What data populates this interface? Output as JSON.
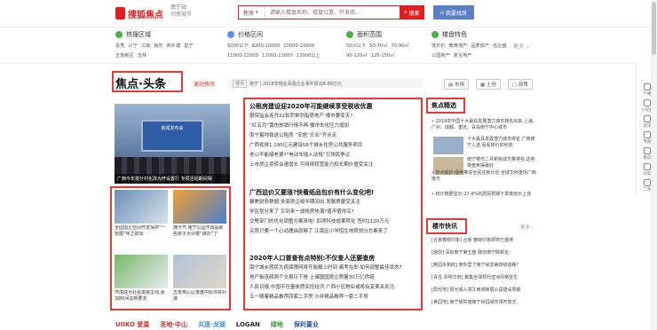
{
  "header": {
    "logo_text": "搜狐焦点",
    "city": "南宁站",
    "city_switch": "切换城市",
    "search_category": "新房",
    "search_placeholder": "请输入楼盘名称、楼盘位置、开发商...",
    "search_button": "搜索",
    "publish_button": "我要找房"
  },
  "categories": [
    {
      "title": "热搜区域",
      "icon_color": "#4caf50",
      "rows": [
        [
          "青秀",
          "兴宁",
          "江南",
          "良庆",
          "西乡塘",
          "邕宁"
        ],
        [
          "五象新区",
          "玉林"
        ]
      ]
    },
    {
      "title": "价格区间",
      "icon_color": "#5b8def",
      "rows": [
        [
          "6000以下",
          "8200-10000",
          "10000-11000"
        ],
        [
          "11000-12000",
          "12000-13000",
          "13000以上"
        ]
      ]
    },
    {
      "title": "面积范围",
      "icon_color": "#4caf50",
      "rows": [
        [
          "50㎡以下",
          "50-70㎡",
          "70-90㎡"
        ],
        [
          "90-120㎡",
          "120-150㎡"
        ]
      ]
    },
    {
      "title": "楼盘特色",
      "icon_color": "#4caf50",
      "rows": [
        [
          "低价价",
          "教育地产",
          "品质房产",
          "名企盘"
        ],
        [
          "公园地产",
          "复合地产"
        ]
      ]
    }
  ],
  "more_label": "更多",
  "focus": {
    "title": "焦点·头条",
    "scroll_tag": "滚动快讯",
    "ticker_tag": "楼市",
    "ticker_text": "南宁 | 2018年物业百强企业事件报出8.66亿元",
    "buttons": [
      "市场",
      "土地",
      "政策"
    ]
  },
  "hero": {
    "stage_text": "新闻发布会",
    "caption": "广西今年将分村化改为开设置行 专项活动期间相"
  },
  "thumbs": [
    {
      "caption": "全国国土空间开发保护“一张图”呼之欲出",
      "color_a": "#6a8fb8",
      "color_b": "#d8e2ea"
    },
    {
      "caption": "拥卡节 南宁公园不再是那些房子大伙楼“谁办”了",
      "color_a": "#f0a030",
      "color_b": "#4a7fd0"
    },
    {
      "caption": "环境成为社会发展主线,更加80间总新要求",
      "color_a": "#78b86a",
      "color_b": "#e8ecef"
    },
    {
      "caption": "五象核心区楼盘中原项目对接",
      "color_a": "#b0c4d8",
      "color_b": "#e0d6c8"
    }
  ],
  "news_blocks": [
    {
      "headline": "公租房建设迎2020年可能继续享受税收优惠",
      "lines": [
        "银保监会连开32张罚单剑指房地产 楼市要变天?",
        "“红五月”黄伤热销行情不再 楼市去化压力增加",
        "南宁着地铁送公租房 “安居”乐业“齐步走",
        "广西省排1.195亿元建设58个城乡住房公共服务项目",
        "老公不能接老婆?“电动车插入法规”引领民争议",
        "上市房企资转业速增长 可持续转营能力和长期价值受关注"
      ]
    },
    {
      "headline": "广西迫价又要涨?快看纸品包价有什么变化吧!",
      "lines": [
        "聚焦财务数据:多家房企收年期间出 发展质量受关注",
        "学区划分来了 又到来一波抢房热潮?值不值得买?",
        "交警部门的优化调整方案来啦!   四项科技成果转化 签约1120万元",
        "买房只要一个心动理由就够了   江南区小学招生地段划分方案来了"
      ]
    },
    {
      "headline": "2020年人口普查有点特别:不仅查人还要查房",
      "lines": [
        "南宁城乡居民大病保障网将开始报上时间   离考在即 如何调整最佳状态?",
        "地产板连续两个交易日下挫   土储国国房企质量30万亿供链",
        "人民日报:中国平仓量体质实控经济   广西小区物业或将有变革关到马",
        "五一随着精品推荐四套二手房   沙井精品推荐一套二手房"
      ]
    }
  ],
  "focus_pick": {
    "title": "焦点精选",
    "lead": "2019年中国十大最具发展潜力城市排名出来,上海、广州、成都、重庆、青岛南宁中心城市",
    "items": [
      {
        "text": "十大最具发展潜力城市排名 广西南宁入选,看看房价如何走",
        "color": "#9ab0c8"
      },
      {
        "text": "南宁楼市二月新房成交量排名,这些楼盘卖得最好",
        "color": "#c8b89a"
      }
    ],
    "points": [
      "热点解析:继续推进全民住房计划 全球华侨重现广西楼市",
      "统计数据显示:27.4%的居民预期下季度房价上涨"
    ]
  },
  "city_news": {
    "title": "楼市快讯",
    "more": "更多",
    "items": [
      "[合景春晓印象] 合景 春晓印象即将已盛排",
      "[融创] 深圳南宁第五盘 融创南宁院新址",
      "[奥园永和府] 使你里了南宁秘享第四级道路?",
      "[青径 青特华府] 聚集全球现代亚洲风格全生",
      "[阳光地] 阳光城入境江南城审展公益建设周期",
      "[世园地] 南宁城实施南宁世园城市领开放式"
    ]
  },
  "sidebar": [
    "个楼",
    "小说板",
    "资讯",
    "专题",
    "看房",
    "问答",
    "二手",
    "更多"
  ],
  "footer_logos": [
    {
      "text": "UIIKO 爱巢",
      "color": "#d03030"
    },
    {
      "text": "圣地·中山",
      "color": "#c83030"
    },
    {
      "text": "共道·龙湖",
      "color": "#3a8fd0"
    },
    {
      "text": "LOGAN",
      "color": "#2a2a2a"
    },
    {
      "text": "绿地",
      "color": "#3a9a3a"
    },
    {
      "text": "保利置业",
      "color": "#2a5aa0"
    }
  ]
}
